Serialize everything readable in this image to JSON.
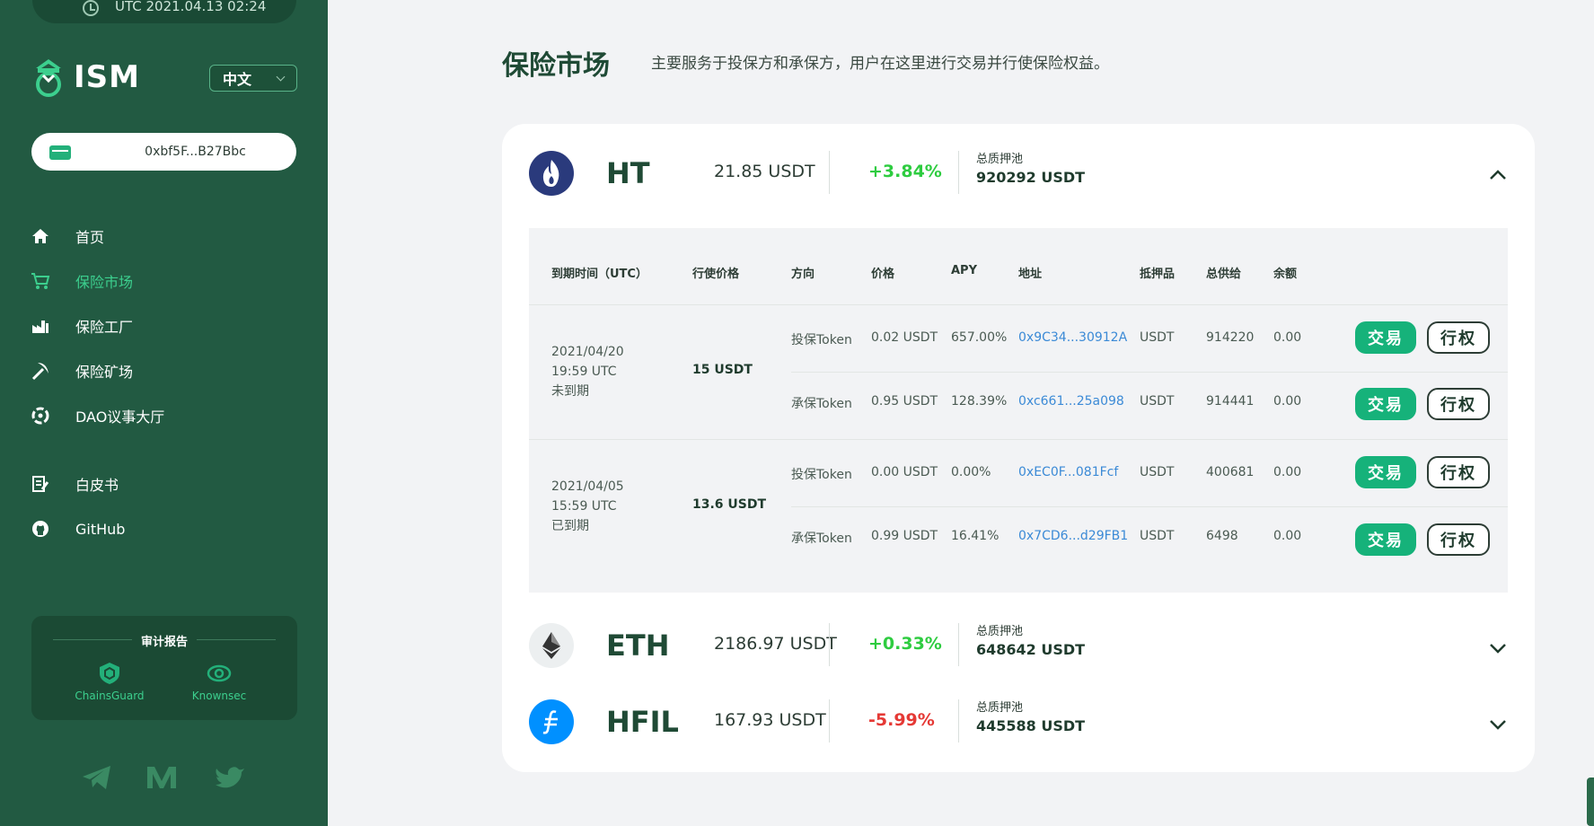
{
  "sidebar": {
    "time": "UTC 2021.04.13 02:24",
    "logo_text": "ISM",
    "language": "中文",
    "wallet_address": "0xbf5F...B27Bbc",
    "nav": [
      {
        "label": "首页",
        "icon": "home-icon",
        "active": false
      },
      {
        "label": "保险市场",
        "icon": "cart-icon",
        "active": true
      },
      {
        "label": "保险工厂",
        "icon": "factory-icon",
        "active": false
      },
      {
        "label": "保险矿场",
        "icon": "pickaxe-icon",
        "active": false
      },
      {
        "label": "DAO议事大厅",
        "icon": "dao-icon",
        "active": false
      },
      {
        "label": "白皮书",
        "icon": "document-icon",
        "active": false
      },
      {
        "label": "GitHub",
        "icon": "github-icon",
        "active": false
      }
    ],
    "audit": {
      "title": "审计报告",
      "auditors": [
        "ChainsGuard",
        "Knownsec"
      ]
    },
    "social": [
      "telegram-icon",
      "medium-icon",
      "twitter-icon"
    ]
  },
  "main": {
    "title": "保险市场",
    "subtitle": "主要服务于投保方和承保方，用户在这里进行交易并行使保险权益。"
  },
  "coins": [
    {
      "symbol": "HT",
      "price": "21.85 USDT",
      "change": "+3.84%",
      "change_color": "#2ecc40",
      "pool_label": "总质押池",
      "pool_value": "920292 USDT",
      "expanded": true
    },
    {
      "symbol": "ETH",
      "price": "2186.97 USDT",
      "change": "+0.33%",
      "change_color": "#2ecc40",
      "pool_label": "总质押池",
      "pool_value": "648642 USDT",
      "expanded": false
    },
    {
      "symbol": "HFIL",
      "price": "167.93 USDT",
      "change": "-5.99%",
      "change_color": "#e53935",
      "pool_label": "总质押池",
      "pool_value": "445588 USDT",
      "expanded": false
    }
  ],
  "table": {
    "headers": [
      "到期时间（UTC）",
      "行使价格",
      "方向",
      "价格",
      "APY",
      "地址",
      "抵押品",
      "总供给",
      "余额"
    ],
    "groups": [
      {
        "date": "2021/04/20",
        "time": "19:59 UTC",
        "status": "未到期",
        "strike": "15 USDT",
        "rows": [
          {
            "direction": "投保Token",
            "price": "0.02 USDT",
            "apy": "657.00%",
            "address": "0x9C34...30912A",
            "collateral": "USDT",
            "supply": "914220",
            "balance": "0.00"
          },
          {
            "direction": "承保Token",
            "price": "0.95 USDT",
            "apy": "128.39%",
            "address": "0xc661...25a098",
            "collateral": "USDT",
            "supply": "914441",
            "balance": "0.00"
          }
        ]
      },
      {
        "date": "2021/04/05",
        "time": "15:59 UTC",
        "status": "已到期",
        "strike": "13.6 USDT",
        "rows": [
          {
            "direction": "投保Token",
            "price": "0.00 USDT",
            "apy": "0.00%",
            "address": "0xEC0F...081Fcf",
            "collateral": "USDT",
            "supply": "400681",
            "balance": "0.00"
          },
          {
            "direction": "承保Token",
            "price": "0.99 USDT",
            "apy": "16.41%",
            "address": "0x7CD6...d29FB1",
            "collateral": "USDT",
            "supply": "6498",
            "balance": "0.00"
          }
        ]
      }
    ],
    "trade_label": "交易",
    "exercise_label": "行权"
  },
  "colors": {
    "sidebar_bg": "#225a42",
    "accent": "#16b27a",
    "link": "#3b8ad6",
    "positive": "#2ecc40",
    "negative": "#e53935"
  }
}
